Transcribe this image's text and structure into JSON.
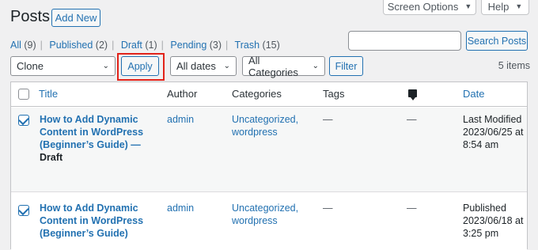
{
  "header": {
    "title": "Posts",
    "add_new": "Add New",
    "screen_options": "Screen Options",
    "help": "Help"
  },
  "views": [
    {
      "label": "All",
      "count": "(9)"
    },
    {
      "label": "Published",
      "count": "(2)"
    },
    {
      "label": "Draft",
      "count": "(1)"
    },
    {
      "label": "Pending",
      "count": "(3)"
    },
    {
      "label": "Trash",
      "count": "(15)"
    }
  ],
  "search": {
    "placeholder": "",
    "button": "Search Posts"
  },
  "toolbar": {
    "bulk_action": "Clone",
    "apply": "Apply",
    "dates": "All dates",
    "categories": "All Categories",
    "filter": "Filter",
    "items_count": "5 items"
  },
  "table": {
    "columns": {
      "title": "Title",
      "author": "Author",
      "categories": "Categories",
      "tags": "Tags",
      "comments_icon": "comment-icon",
      "date": "Date"
    },
    "rows": [
      {
        "title_lines": [
          "How to Add Dynamic",
          "Content in WordPress",
          "(Beginner’s Guide) —"
        ],
        "state": "Draft",
        "author": "admin",
        "categories": [
          "Uncategorized,",
          "wordpress"
        ],
        "tags": "—",
        "comments": "—",
        "date": [
          "Last Modified",
          "2023/06/25 at",
          "8:54 am"
        ]
      },
      {
        "title_lines": [
          "How to Add Dynamic",
          "Content in WordPress",
          "(Beginner’s Guide)"
        ],
        "state": "",
        "author": "admin",
        "categories": [
          "Uncategorized,",
          "wordpress"
        ],
        "tags": "—",
        "comments": "—",
        "date": [
          "Published",
          "2023/06/18 at",
          "3:25 pm"
        ]
      }
    ]
  }
}
